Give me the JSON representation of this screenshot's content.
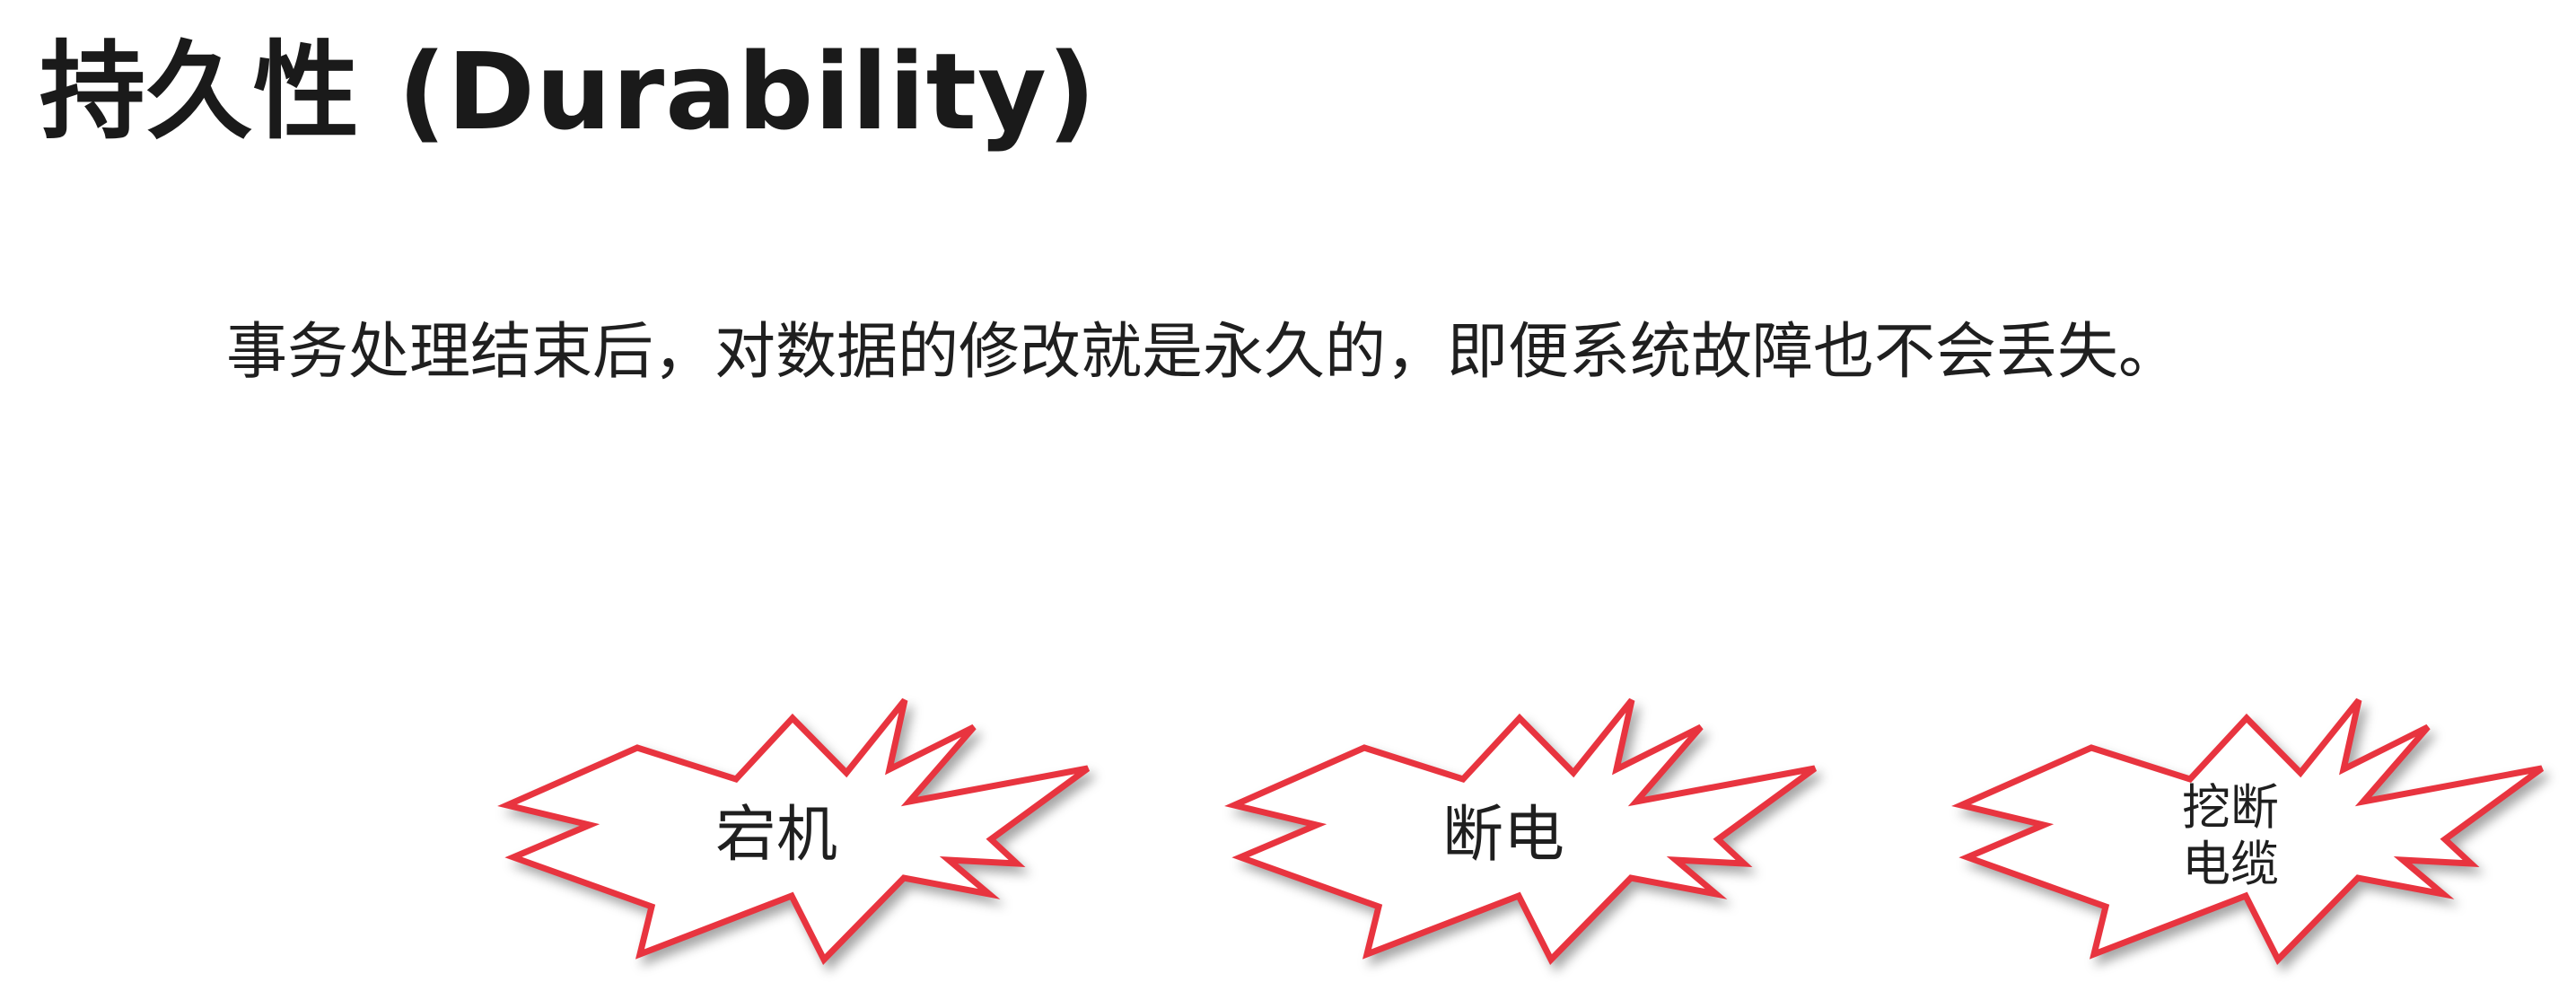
{
  "slide": {
    "title": "持久性 (Durability)",
    "description": "事务处理结束后，对数据的修改就是永久的，即便系统故障也不会丢失。"
  },
  "bursts": [
    {
      "lines": [
        "宕机"
      ]
    },
    {
      "lines": [
        "断电"
      ]
    },
    {
      "lines": [
        "挖断",
        "电缆"
      ]
    }
  ],
  "colors": {
    "burst_stroke": "#e8343f",
    "text": "#1f1f1f"
  }
}
